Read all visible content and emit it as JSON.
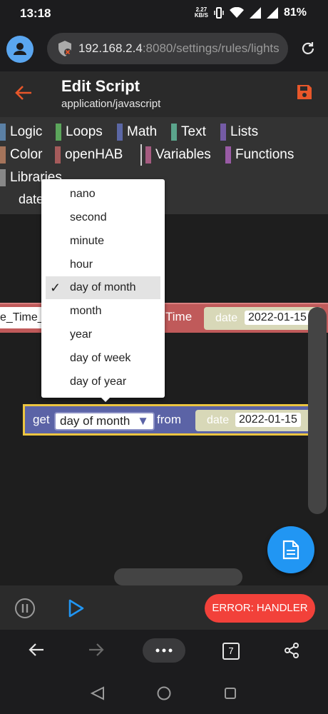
{
  "status": {
    "time": "13:18",
    "speed_top": "2.27",
    "speed_bottom": "KB/S",
    "battery": "81%"
  },
  "browser": {
    "url_host": "192.168.2.4",
    "url_rest": ":8080/settings/rules/lights",
    "tab_count": "7"
  },
  "header": {
    "title": "Edit Script",
    "subtitle": "application/javascript"
  },
  "toolbox": {
    "categories": [
      {
        "label": "Logic",
        "color": "#5b80a5"
      },
      {
        "label": "Loops",
        "color": "#5ba55b"
      },
      {
        "label": "Math",
        "color": "#5b67a5"
      },
      {
        "label": "Text",
        "color": "#5ba58c"
      },
      {
        "label": "Lists",
        "color": "#745ba5"
      },
      {
        "label": "Color",
        "color": "#a5745b"
      },
      {
        "label": "openHAB",
        "color": "#a55b5b"
      },
      {
        "label": "Variables",
        "color": "#a55b80"
      },
      {
        "label": "Functions",
        "color": "#995ba5"
      },
      {
        "label": "Libraries",
        "color": "#888888"
      }
    ],
    "sub_item": "date"
  },
  "blocks": {
    "top": {
      "left_text": "e_Time_",
      "mid_text": "Time",
      "date_label": "date",
      "date_value": "2022-01-15"
    },
    "get": {
      "get_label": "get",
      "selected": "day of month",
      "from_label": "from",
      "date_label": "date",
      "date_value": "2022-01-15"
    }
  },
  "dropdown": {
    "options": [
      "nano",
      "second",
      "minute",
      "hour",
      "day of month",
      "month",
      "year",
      "day of week",
      "day of year"
    ],
    "selected_index": 4,
    "check": "✓"
  },
  "bottom": {
    "error_label": "ERROR: HANDLER"
  },
  "colors": {
    "accent": "#e8572a",
    "fab": "#2196f3",
    "error": "#f2413a",
    "block_top": "#c05a5a",
    "block_get": "#5b63a6",
    "select_outline": "#ecc540"
  }
}
